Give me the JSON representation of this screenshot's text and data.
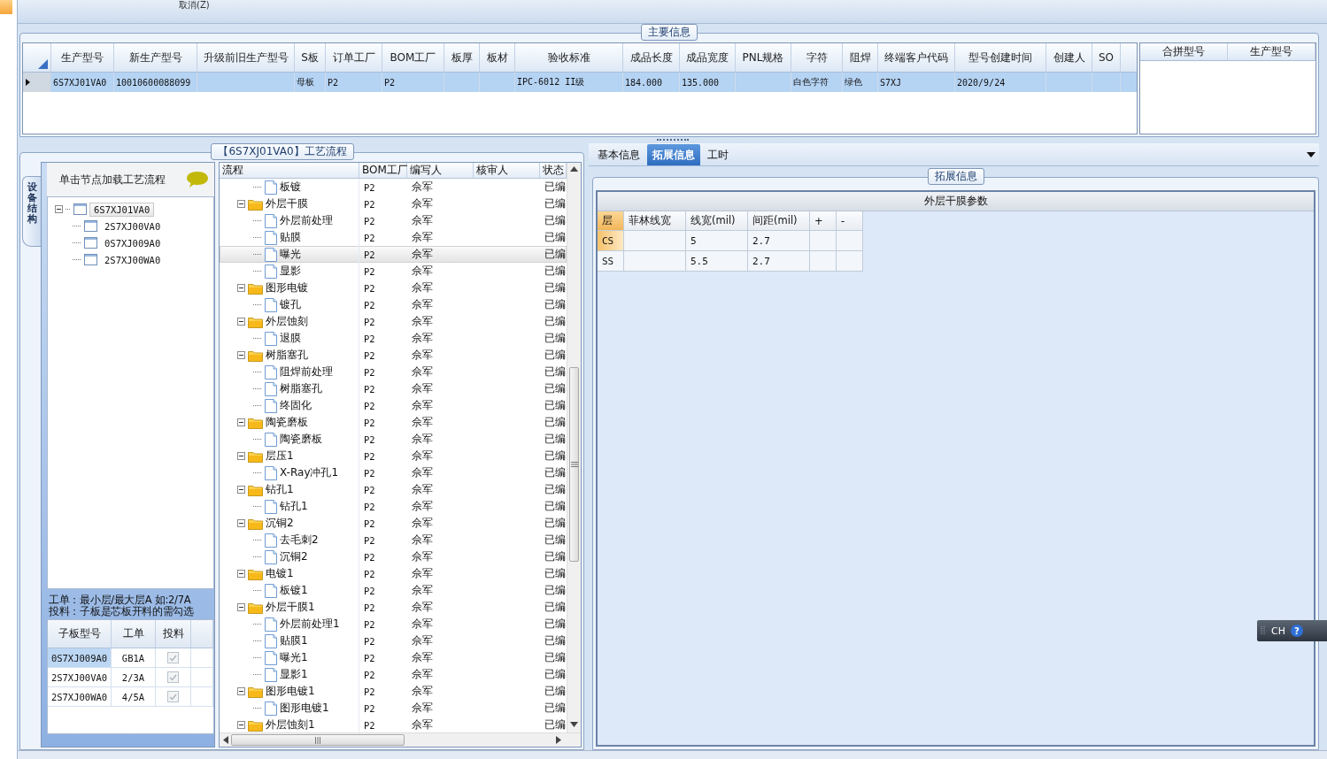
{
  "toolbar": {
    "cancel_label": "取消(Z)"
  },
  "main_info": {
    "title": "主要信息",
    "columns": [
      "生产型号",
      "新生产型号",
      "升级前旧生产型号",
      "S板",
      "订单工厂",
      "BOM工厂",
      "板厚",
      "板材",
      "验收标准",
      "成品长度",
      "成品宽度",
      "PNL规格",
      "字符",
      "阻焊",
      "终端客户代码",
      "型号创建时间",
      "创建人",
      "SO"
    ],
    "rows": [
      {
        "selected": true,
        "cells": [
          "6S7XJ01VA0",
          "10010600088099",
          null,
          "母板",
          "P2",
          "P2",
          null,
          null,
          "IPC-6012 II级",
          "184.000",
          "135.000",
          null,
          "白色字符",
          "绿色",
          "S7XJ",
          "2020/9/24",
          null,
          null
        ]
      }
    ],
    "merge_columns": [
      "合拼型号",
      "生产型号"
    ]
  },
  "structure_panel": {
    "tab": "设备结构",
    "hint": "单击节点加载工艺流程",
    "tree": {
      "label": "6S7XJ01VA0",
      "selected": true,
      "expanded": true,
      "children": [
        {
          "label": "2S7XJ00VA0",
          "selected": false
        },
        {
          "label": "0S7XJ009A0",
          "selected": false
        },
        {
          "label": "2S7XJ00WA0",
          "selected": false
        }
      ]
    },
    "note_lines": [
      "工单：最小层/最大层A 如:2/7A",
      "投料：子板是芯板开料的需勾选"
    ],
    "sub_columns": [
      "子板型号",
      "工单",
      "投料"
    ],
    "sub_rows": [
      {
        "selected": true,
        "model": "0S7XJ009A0",
        "order": "GB1A",
        "feed_checked": true
      },
      {
        "selected": false,
        "model": "2S7XJ00VA0",
        "order": "2/3A",
        "feed_checked": true
      },
      {
        "selected": false,
        "model": "2S7XJ00WA0",
        "order": "4/5A",
        "feed_checked": true
      }
    ]
  },
  "flow_panel": {
    "title": "【6S7XJ01VA0】工艺流程",
    "columns": [
      "流程",
      "BOM工厂",
      "编写人",
      "核审人",
      "状态"
    ],
    "rows": [
      {
        "kind": "step",
        "name": "板镀",
        "bom": "P2",
        "writer": "佘军",
        "status": "已编",
        "selected": false
      },
      {
        "kind": "group",
        "name": "外层干膜",
        "bom": "P2",
        "writer": "佘军",
        "status": "已编",
        "selected": false,
        "expanded": true,
        "children": [
          {
            "kind": "step",
            "name": "外层前处理",
            "bom": "P2",
            "writer": "佘军",
            "status": "已编",
            "selected": false
          },
          {
            "kind": "step",
            "name": "贴膜",
            "bom": "P2",
            "writer": "佘军",
            "status": "已编",
            "selected": false
          },
          {
            "kind": "step",
            "name": "曝光",
            "bom": "P2",
            "writer": "佘军",
            "status": "已编",
            "selected": true
          },
          {
            "kind": "step",
            "name": "显影",
            "bom": "P2",
            "writer": "佘军",
            "status": "已编",
            "selected": false
          }
        ]
      },
      {
        "kind": "group",
        "name": "图形电镀",
        "bom": "P2",
        "writer": "佘军",
        "status": "已编",
        "selected": false,
        "expanded": true,
        "children": [
          {
            "kind": "step",
            "name": "镀孔",
            "bom": "P2",
            "writer": "佘军",
            "status": "已编",
            "selected": false
          }
        ]
      },
      {
        "kind": "group",
        "name": "外层蚀刻",
        "bom": "P2",
        "writer": "佘军",
        "status": "已编",
        "selected": false,
        "expanded": true,
        "children": [
          {
            "kind": "step",
            "name": "退膜",
            "bom": "P2",
            "writer": "佘军",
            "status": "已编",
            "selected": false
          }
        ]
      },
      {
        "kind": "group",
        "name": "树脂塞孔",
        "bom": "P2",
        "writer": "佘军",
        "status": "已编",
        "selected": false,
        "expanded": true,
        "children": [
          {
            "kind": "step",
            "name": "阻焊前处理",
            "bom": "P2",
            "writer": "佘军",
            "status": "已编",
            "selected": false
          },
          {
            "kind": "step",
            "name": "树脂塞孔",
            "bom": "P2",
            "writer": "佘军",
            "status": "已编",
            "selected": false
          },
          {
            "kind": "step",
            "name": "终固化",
            "bom": "P2",
            "writer": "佘军",
            "status": "已编",
            "selected": false
          }
        ]
      },
      {
        "kind": "group",
        "name": "陶瓷磨板",
        "bom": "P2",
        "writer": "佘军",
        "status": "已编",
        "selected": false,
        "expanded": true,
        "children": [
          {
            "kind": "step",
            "name": "陶瓷磨板",
            "bom": "P2",
            "writer": "佘军",
            "status": "已编",
            "selected": false
          }
        ]
      },
      {
        "kind": "group",
        "name": "层压1",
        "bom": "P2",
        "writer": "佘军",
        "status": "已编",
        "selected": false,
        "expanded": true,
        "children": [
          {
            "kind": "step",
            "name": "X-Ray冲孔1",
            "bom": "P2",
            "writer": "佘军",
            "status": "已编",
            "selected": false
          }
        ]
      },
      {
        "kind": "group",
        "name": "钻孔1",
        "bom": "P2",
        "writer": "佘军",
        "status": "已编",
        "selected": false,
        "expanded": true,
        "children": [
          {
            "kind": "step",
            "name": "钻孔1",
            "bom": "P2",
            "writer": "佘军",
            "status": "已编",
            "selected": false
          }
        ]
      },
      {
        "kind": "group",
        "name": "沉铜2",
        "bom": "P2",
        "writer": "佘军",
        "status": "已编",
        "selected": false,
        "expanded": true,
        "children": [
          {
            "kind": "step",
            "name": "去毛刺2",
            "bom": "P2",
            "writer": "佘军",
            "status": "已编",
            "selected": false
          },
          {
            "kind": "step",
            "name": "沉铜2",
            "bom": "P2",
            "writer": "佘军",
            "status": "已编",
            "selected": false
          }
        ]
      },
      {
        "kind": "group",
        "name": "电镀1",
        "bom": "P2",
        "writer": "佘军",
        "status": "已编",
        "selected": false,
        "expanded": true,
        "children": [
          {
            "kind": "step",
            "name": "板镀1",
            "bom": "P2",
            "writer": "佘军",
            "status": "已编",
            "selected": false
          }
        ]
      },
      {
        "kind": "group",
        "name": "外层干膜1",
        "bom": "P2",
        "writer": "佘军",
        "status": "已编",
        "selected": false,
        "expanded": true,
        "children": [
          {
            "kind": "step",
            "name": "外层前处理1",
            "bom": "P2",
            "writer": "佘军",
            "status": "已编",
            "selected": false
          },
          {
            "kind": "step",
            "name": "贴膜1",
            "bom": "P2",
            "writer": "佘军",
            "status": "已编",
            "selected": false
          },
          {
            "kind": "step",
            "name": "曝光1",
            "bom": "P2",
            "writer": "佘军",
            "status": "已编",
            "selected": false
          },
          {
            "kind": "step",
            "name": "显影1",
            "bom": "P2",
            "writer": "佘军",
            "status": "已编",
            "selected": false
          }
        ]
      },
      {
        "kind": "group",
        "name": "图形电镀1",
        "bom": "P2",
        "writer": "佘军",
        "status": "已编",
        "selected": false,
        "expanded": true,
        "children": [
          {
            "kind": "step",
            "name": "图形电镀1",
            "bom": "P2",
            "writer": "佘军",
            "status": "已编",
            "selected": false
          }
        ]
      },
      {
        "kind": "group",
        "name": "外层蚀刻1",
        "bom": "P2",
        "writer": "佘军",
        "status": "已编",
        "selected": false,
        "expanded": true
      }
    ]
  },
  "detail_panel": {
    "tabs": [
      {
        "label": "基本信息",
        "selected": false
      },
      {
        "label": "拓展信息",
        "selected": true
      },
      {
        "label": "工时",
        "selected": false
      }
    ],
    "group_title": "拓展信息",
    "grid": {
      "title": "外层干膜参数",
      "columns": [
        "层",
        "菲林线宽",
        "线宽(mil)",
        "间距(mil)",
        "+",
        "-"
      ],
      "rows": [
        {
          "selected": true,
          "cells": [
            "CS",
            null,
            "5",
            "2.7",
            null,
            null
          ]
        },
        {
          "selected": false,
          "cells": [
            "SS",
            null,
            "5.5",
            "2.7",
            null,
            null
          ]
        }
      ]
    }
  },
  "ime": {
    "label": "CH",
    "help": "?"
  }
}
